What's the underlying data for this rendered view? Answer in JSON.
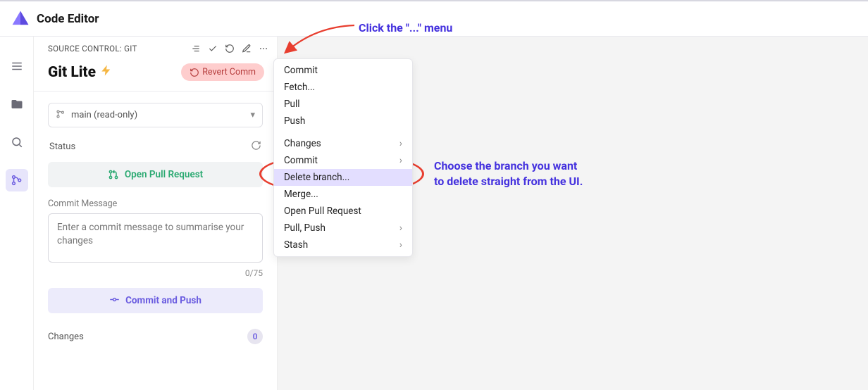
{
  "app": {
    "title": "Code Editor"
  },
  "panel": {
    "header": "SOURCE CONTROL: GIT",
    "repo_name": "Git Lite",
    "revert_label": "Revert Comm",
    "branch": "main (read-only)",
    "status_label": "Status",
    "open_pr": "Open Pull Request",
    "commit_msg_label": "Commit Message",
    "commit_placeholder": "Enter a commit message to summarise your changes",
    "counter": "0/75",
    "commit_push": "Commit and Push",
    "changes_label": "Changes",
    "changes_count": "0"
  },
  "menu": {
    "items": [
      {
        "label": "Commit",
        "submenu": false
      },
      {
        "label": "Fetch...",
        "submenu": false
      },
      {
        "label": "Pull",
        "submenu": false
      },
      {
        "label": "Push",
        "submenu": false
      },
      {
        "label": "Changes",
        "submenu": true
      },
      {
        "label": "Commit",
        "submenu": true
      },
      {
        "label": "Delete branch...",
        "submenu": false,
        "highlight": true
      },
      {
        "label": "Merge...",
        "submenu": false
      },
      {
        "label": "Open Pull Request",
        "submenu": false
      },
      {
        "label": "Pull, Push",
        "submenu": true
      },
      {
        "label": "Stash",
        "submenu": true
      }
    ]
  },
  "annotations": {
    "top": "Click the \"...\" menu",
    "side": "Choose the branch you want to delete straight from the UI."
  }
}
